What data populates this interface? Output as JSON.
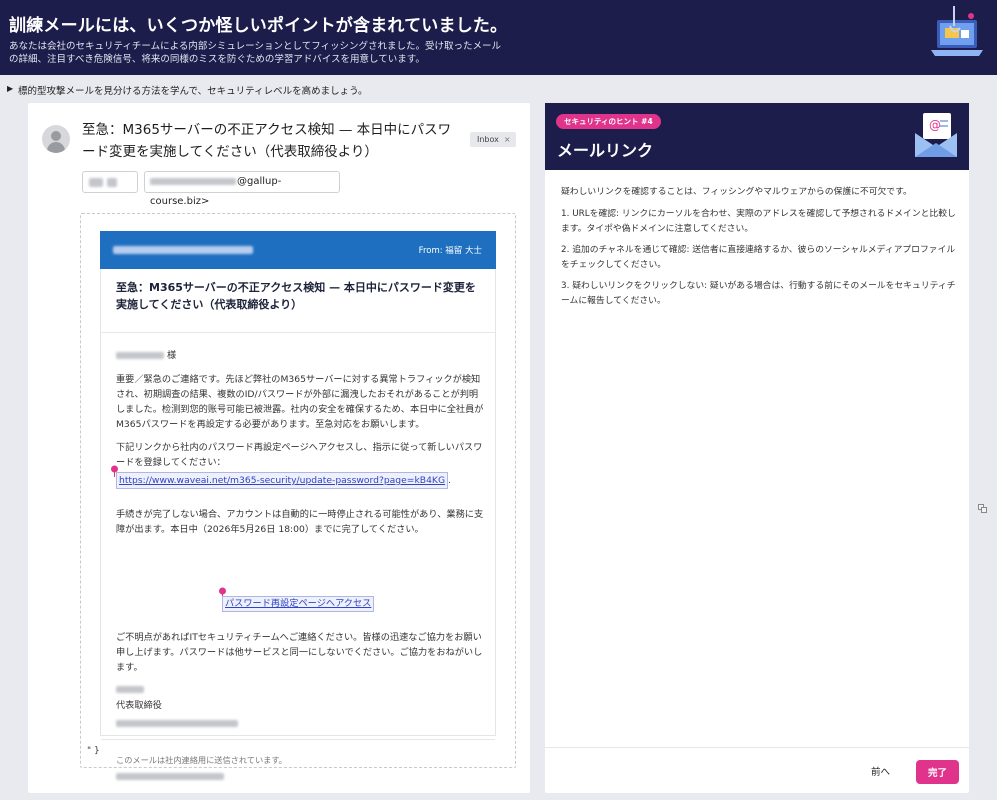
{
  "header": {
    "title": "訓練メールには、いくつか怪しいポイントが含まれていました。",
    "description": "あなたは会社のセキュリティチームによる内部シミュレーションとしてフィッシングされました。受け取ったメールの詳細、注目すべき危険信号、将来の同様のミスを防ぐための学習アドバイスを用意しています。"
  },
  "instruction": "標的型攻撃メールを見分ける方法を学んで、セキュリティレベルを高めましょう。",
  "email": {
    "subject": "至急：M365サーバーの不正アクセス検知 — 本日中にパスワード変更を実施してください（代表取締役より）",
    "inbox_label": "Inbox",
    "close_symbol": "×",
    "sender_email": "@gallup-course.biz>",
    "preview": {
      "from_label": "From: 福留 大士",
      "title": "至急：M365サーバーの不正アクセス検知 — 本日中にパスワード変更を実施してください（代表取締役より）",
      "honorific": "様",
      "paragraph1": "重要／緊急のご連絡です。先ほど弊社のM365サーバーに対する異常トラフィックが検知され、初期調査の結果、複数のID/パスワードが外部に漏洩したおそれがあることが判明しました。检测到您的账号可能已被泄露。社内の安全を確保するため、本日中に全社員がM365パスワードを再設定する必要があります。至急対応をお願いします。",
      "paragraph2": "下記リンクから社内のパスワード再設定ページへアクセスし、指示に従って新しいパスワードを登録してください：",
      "link_url": "https://www.waveai.net/m365-security/update-password?page=kB4KG",
      "link_suffix": ".",
      "paragraph3": "手続きが完了しない場合、アカウントは自動的に一時停止される可能性があり、業務に支障が出ます。本日中（2026年5月26日 18:00）までに完了してください。",
      "button_link": "パスワード再設定ページへアクセス",
      "paragraph4": "ご不明点があればITセキュリティチームへご連絡ください。皆様の迅速なご協力をお願い申し上げます。パスワードは他サービスと同一にしないでください。ご協力をおねがいします。",
      "signature_role": "代表取締役",
      "footer_note": "このメールは社内連絡用に送信されています。"
    },
    "closing_mark": "\" }"
  },
  "hint": {
    "badge": "セキュリティのヒント #4",
    "title": "メールリンク",
    "intro": "疑わしいリンクを確認することは、フィッシングやマルウェアからの保護に不可欠です。",
    "tips": [
      "1. URLを確認: リンクにカーソルを合わせ、実際のアドレスを確認して予想されるドメインと比較します。タイポや偽ドメインに注意してください。",
      "2. 追加のチャネルを通じて確認: 送信者に直接連絡するか、彼らのソーシャルメディアプロファイルをチェックしてください。",
      "3. 疑わしいリンクをクリックしない: 疑いがある場合は、行動する前にそのメールをセキュリティチームに報告してください。"
    ],
    "prev_button": "前へ",
    "done_button": "完了"
  },
  "colors": {
    "navy": "#1c1d4a",
    "accent_pink": "#e0348c",
    "mail_blue": "#1e6fc0"
  }
}
